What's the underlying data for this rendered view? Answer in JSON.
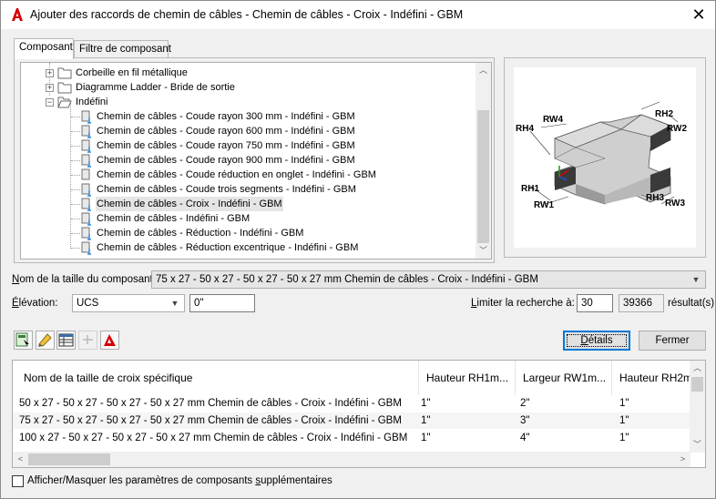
{
  "window": {
    "title": "Ajouter des raccords de chemin de câbles - Chemin de câbles - Croix - Indéfini - GBM"
  },
  "tabs": [
    {
      "label": "Composant"
    },
    {
      "label": "Filtre de composant"
    }
  ],
  "tree": {
    "folders": [
      {
        "label": "Corbeille en fil métallique"
      },
      {
        "label": "Diagramme Ladder - Bride de sortie"
      },
      {
        "label": "Indéfini"
      }
    ],
    "items": [
      {
        "label": "Chemin de câbles - Coude rayon 300 mm - Indéfini - GBM"
      },
      {
        "label": "Chemin de câbles - Coude rayon 600 mm - Indéfini - GBM"
      },
      {
        "label": "Chemin de câbles - Coude rayon 750 mm - Indéfini - GBM"
      },
      {
        "label": "Chemin de câbles - Coude rayon 900 mm - Indéfini - GBM"
      },
      {
        "label": "Chemin de câbles - Coude réduction en onglet - Indéfini - GBM"
      },
      {
        "label": "Chemin de câbles - Coude trois segments - Indéfini - GBM"
      },
      {
        "label": "Chemin de câbles - Croix - Indéfini - GBM"
      },
      {
        "label": "Chemin de câbles - Indéfini - GBM"
      },
      {
        "label": "Chemin de câbles - Réduction - Indéfini - GBM"
      },
      {
        "label": "Chemin de câbles - Réduction excentrique - Indéfini - GBM"
      }
    ],
    "selected_index": 6
  },
  "preview": {
    "labels": {
      "rh4": "RH4",
      "rw4": "RW4",
      "rh2": "RH2",
      "rw2": "RW2",
      "rh1": "RH1",
      "rw1": "RW1",
      "rh3": "RH3",
      "rw3": "RW3"
    }
  },
  "size": {
    "label_prefix": "N",
    "label_rest": "om de la taille du composant:",
    "value": "75 x 27 - 50 x 27 - 50 x 27 - 50 x 27 mm Chemin de câbles - Croix - Indéfini - GBM"
  },
  "elevation": {
    "label_prefix": "É",
    "label_rest": "lévation:",
    "mode": "UCS",
    "value": "0\""
  },
  "limit": {
    "label_prefix": "L",
    "label_rest": "imiter la recherche à:",
    "value": "30",
    "results": "39366",
    "results_suffix": "résultat(s)"
  },
  "buttons": {
    "details_prefix": "D",
    "details_rest": "étails",
    "close": "Fermer"
  },
  "grid": {
    "columns": [
      "Nom de la taille de croix spécifique",
      "Hauteur RH1m...",
      "Largeur RW1m...",
      "Hauteur RH2m"
    ],
    "rows": [
      [
        "50 x 27 - 50 x 27 - 50 x 27 - 50 x 27 mm Chemin de câbles - Croix - Indéfini - GBM",
        "1\"",
        "2\"",
        "1\""
      ],
      [
        "75 x 27 - 50 x 27 - 50 x 27 - 50 x 27 mm Chemin de câbles - Croix - Indéfini - GBM",
        "1\"",
        "3\"",
        "1\""
      ],
      [
        "100 x 27 - 50 x 27 - 50 x 27 - 50 x 27 mm Chemin de câbles - Croix - Indéfini - GBM",
        "1\"",
        "4\"",
        "1\""
      ]
    ]
  },
  "footer": {
    "checkbox_label_a": "Afficher/Masquer les paramètres de composants ",
    "checkbox_label_u": "s",
    "checkbox_label_b": "upplémentaires",
    "checked": false
  }
}
